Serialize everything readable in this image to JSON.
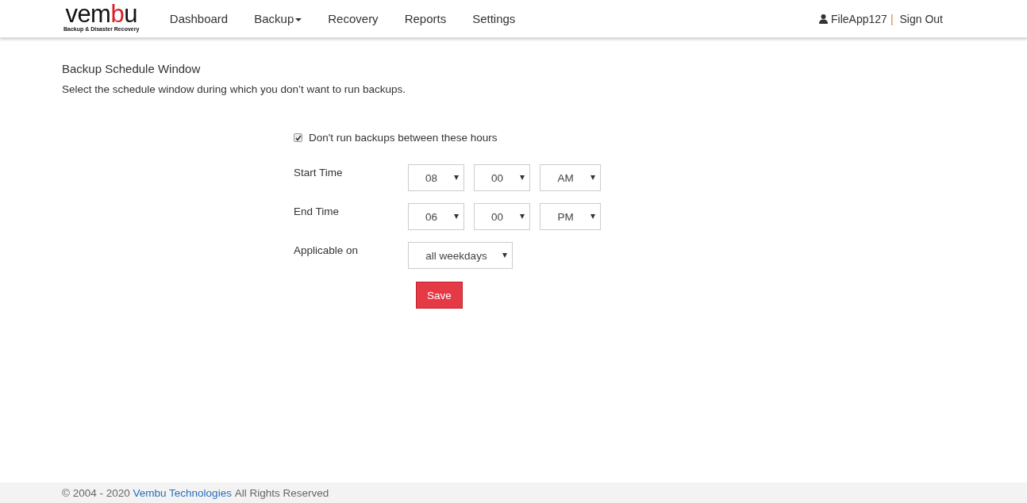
{
  "logo": {
    "word_start": "vem",
    "word_accent": "b",
    "word_end": "u",
    "tagline": "Backup & Disaster Recovery"
  },
  "nav": [
    {
      "label": "Dashboard",
      "dropdown": false
    },
    {
      "label": "Backup",
      "dropdown": true
    },
    {
      "label": "Recovery",
      "dropdown": false
    },
    {
      "label": "Reports",
      "dropdown": false
    },
    {
      "label": "Settings",
      "dropdown": false
    }
  ],
  "user": {
    "name": "FileApp127",
    "separator": "|",
    "sign_out": "Sign Out"
  },
  "page": {
    "title": "Backup Schedule Window",
    "description": "Select the schedule window during which you don’t want to run backups."
  },
  "form": {
    "checkbox": {
      "label": "Don't run backups between these hours",
      "checked": true
    },
    "rows": [
      {
        "label": "Start Time",
        "selects": [
          "08",
          "00",
          "AM"
        ]
      },
      {
        "label": "End Time",
        "selects": [
          "06",
          "00",
          "PM"
        ]
      },
      {
        "label": "Applicable on",
        "selects": [
          "all weekdays"
        ]
      }
    ],
    "save": "Save"
  },
  "footer": {
    "copyright": "©",
    "years": "2004 - 2020",
    "link": "Vembu Technologies",
    "rest": "All Rights Reserved"
  }
}
